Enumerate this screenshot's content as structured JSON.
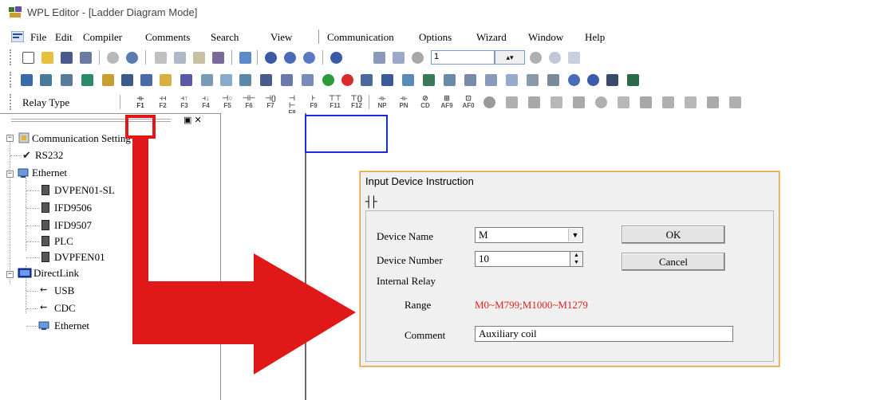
{
  "window": {
    "title": "WPL Editor - [Ladder Diagram Mode]"
  },
  "menu": {
    "items": [
      "File",
      "Edit",
      "Compiler",
      "Comments",
      "Search",
      "View",
      "Communication",
      "Options",
      "Wizard",
      "Window",
      "Help"
    ]
  },
  "toolbar": {
    "station_value": "1"
  },
  "relay_toolbar": {
    "label": "Relay Type",
    "keys": [
      {
        "sym": "⫞⊦",
        "key": "F1"
      },
      {
        "sym": "⫞⫞",
        "key": "F2"
      },
      {
        "sym": "⫞↑",
        "key": "F3"
      },
      {
        "sym": "⫞↓",
        "key": "F4"
      },
      {
        "sym": "⊣○",
        "key": "F5"
      },
      {
        "sym": "⊣⊢",
        "key": "F6"
      },
      {
        "sym": "⊣()",
        "key": "F7"
      },
      {
        "sym": "⊣ ⊢",
        "key": "F8"
      },
      {
        "sym": "⊦",
        "key": "F9"
      },
      {
        "sym": "⊤⊤",
        "key": "F11"
      },
      {
        "sym": "⊤{}",
        "key": "F12"
      }
    ],
    "keys2": [
      {
        "sym": "⫞⊦",
        "key": "NP"
      },
      {
        "sym": "⫞⊦",
        "key": "PN"
      },
      {
        "sym": "⊘",
        "key": "CD"
      },
      {
        "sym": "⊞",
        "key": "AF9"
      },
      {
        "sym": "⊡",
        "key": "AF0"
      }
    ]
  },
  "tree": {
    "root": "Communication Setting",
    "rs232": "RS232",
    "ethernet": "Ethernet",
    "eth_items": [
      "DVPEN01-SL",
      "IFD9506",
      "IFD9507",
      "PLC",
      "DVPFEN01"
    ],
    "directlink": "DirectLink",
    "dl_items": [
      "USB",
      "CDC",
      "Ethernet"
    ]
  },
  "dialog": {
    "title": "Input Device Instruction",
    "symbol": "┤├",
    "device_name_label": "Device Name",
    "device_name_value": "M",
    "device_number_label": "Device Number",
    "device_number_value": "10",
    "type_label": "Internal Relay",
    "range_label": "Range",
    "range_value": "M0~M799;M1000~M1279",
    "comment_label": "Comment",
    "comment_value": "Auxiliary coil",
    "ok_label": "OK",
    "cancel_label": "Cancel"
  },
  "colors": {
    "annotation_red": "#e01818",
    "range_text": "#e02020",
    "dialog_border": "#e9a13a",
    "cursor_blue": "#1a2bd8"
  }
}
